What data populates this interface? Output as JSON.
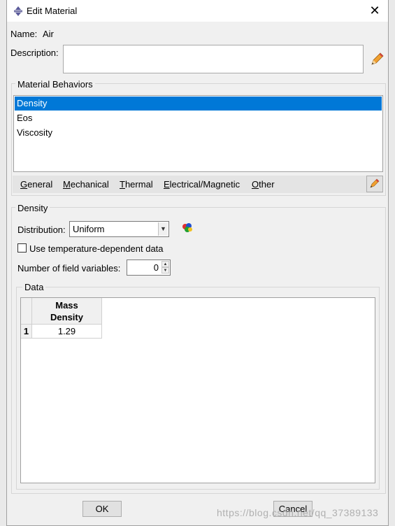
{
  "window": {
    "title": "Edit Material",
    "close_symbol": "✕"
  },
  "material": {
    "name_label": "Name:",
    "name_value": "Air",
    "description_label": "Description:",
    "description_value": ""
  },
  "behaviors": {
    "group_title": "Material Behaviors",
    "items": [
      "Density",
      "Eos",
      "Viscosity"
    ],
    "selected_index": 0
  },
  "menu": {
    "items": [
      {
        "first": "G",
        "rest": "eneral"
      },
      {
        "first": "M",
        "rest": "echanical"
      },
      {
        "first": "T",
        "rest": "hermal"
      },
      {
        "first": "E",
        "rest": "lectrical/Magnetic"
      },
      {
        "first": "O",
        "rest": "ther"
      }
    ]
  },
  "density": {
    "group_title": "Density",
    "distribution_label": "Distribution:",
    "distribution_value": "Uniform",
    "temp_dependent_label": "Use temperature-dependent data",
    "temp_dependent_checked": false,
    "field_vars_label": "Number of field variables:",
    "field_vars_value": "0",
    "data_group_title": "Data",
    "table": {
      "column_header_line1": "Mass",
      "column_header_line2": "Density",
      "row_number": "1",
      "value": "1.29"
    }
  },
  "buttons": {
    "ok": "OK",
    "cancel": "Cancel"
  },
  "watermark": "https://blog.csdn.net/qq_37389133",
  "colors": {
    "selection": "#0078d7",
    "window_bg": "#f0f0f0"
  }
}
